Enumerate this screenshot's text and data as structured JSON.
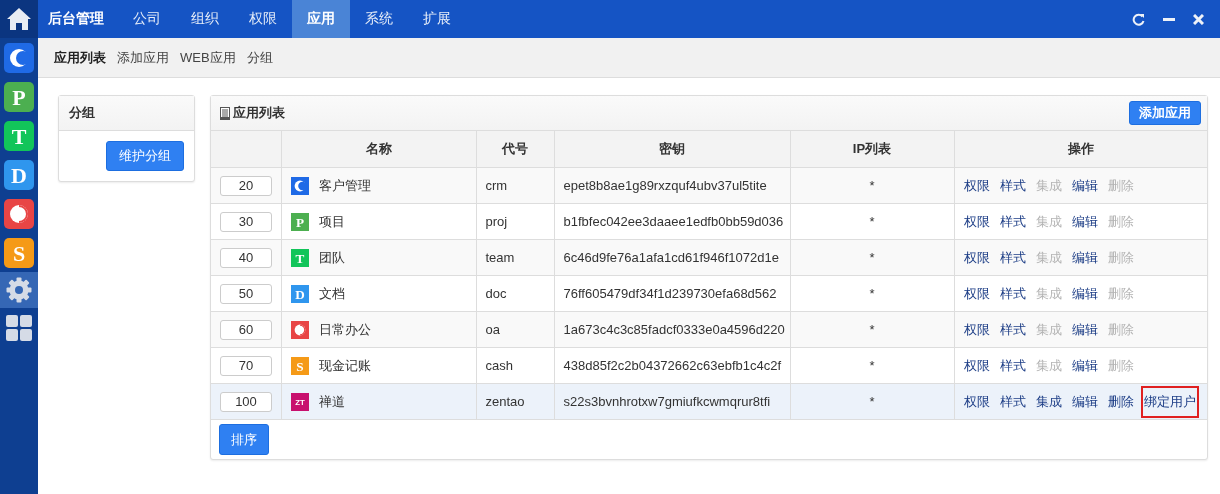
{
  "topbar": {
    "title": "后台管理",
    "tabs": [
      {
        "label": "公司",
        "selected": false
      },
      {
        "label": "组织",
        "selected": false
      },
      {
        "label": "权限",
        "selected": false
      },
      {
        "label": "应用",
        "selected": true
      },
      {
        "label": "系统",
        "selected": false
      },
      {
        "label": "扩展",
        "selected": false
      }
    ]
  },
  "sidebar": {
    "items": [
      {
        "kind": "crescent",
        "color": "#1f6ae6",
        "selected": false
      },
      {
        "kind": "letter",
        "glyph": "P",
        "color": "#4caf50",
        "selected": false
      },
      {
        "kind": "letter",
        "glyph": "T",
        "color": "#12c55a",
        "selected": false
      },
      {
        "kind": "letter",
        "glyph": "D",
        "color": "#2f96ee",
        "selected": false
      },
      {
        "kind": "half",
        "color": "#e84545",
        "selected": false
      },
      {
        "kind": "letter",
        "glyph": "S",
        "color": "#f59a17",
        "selected": false
      },
      {
        "kind": "gear",
        "selected": true
      },
      {
        "kind": "grid",
        "selected": false
      }
    ]
  },
  "subnav": [
    {
      "label": "应用列表",
      "selected": true
    },
    {
      "label": "添加应用",
      "selected": false
    },
    {
      "label": "WEB应用",
      "selected": false
    },
    {
      "label": "分组",
      "selected": false
    }
  ],
  "group_panel": {
    "title": "分组",
    "button": "维护分组"
  },
  "app_panel": {
    "title": "应用列表",
    "add_button": "添加应用",
    "columns": [
      "名称",
      "代号",
      "密钥",
      "IP列表",
      "操作"
    ],
    "rows": [
      {
        "order": "20",
        "icon": {
          "kind": "crescent",
          "color": "#1f6ae6"
        },
        "name": "客户管理",
        "code": "crm",
        "key": "epet8b8ae1g89rxzquf4ubv37ul5tite",
        "ip": "*",
        "highlighted": false,
        "actions": [
          {
            "label": "权限",
            "disabled": false,
            "outlined": false
          },
          {
            "label": "样式",
            "disabled": false,
            "outlined": false
          },
          {
            "label": "集成",
            "disabled": true,
            "outlined": false
          },
          {
            "label": "编辑",
            "disabled": false,
            "outlined": false
          },
          {
            "label": "删除",
            "disabled": true,
            "outlined": false
          }
        ]
      },
      {
        "order": "30",
        "icon": {
          "kind": "letter",
          "glyph": "P",
          "color": "#4caf50"
        },
        "name": "项目",
        "code": "proj",
        "key": "b1fbfec042ee3daaee1edfb0bb59d036",
        "ip": "*",
        "highlighted": false,
        "actions": [
          {
            "label": "权限",
            "disabled": false,
            "outlined": false
          },
          {
            "label": "样式",
            "disabled": false,
            "outlined": false
          },
          {
            "label": "集成",
            "disabled": true,
            "outlined": false
          },
          {
            "label": "编辑",
            "disabled": false,
            "outlined": false
          },
          {
            "label": "删除",
            "disabled": true,
            "outlined": false
          }
        ]
      },
      {
        "order": "40",
        "icon": {
          "kind": "letter",
          "glyph": "T",
          "color": "#12c55a"
        },
        "name": "团队",
        "code": "team",
        "key": "6c46d9fe76a1afa1cd61f946f1072d1e",
        "ip": "*",
        "highlighted": false,
        "actions": [
          {
            "label": "权限",
            "disabled": false,
            "outlined": false
          },
          {
            "label": "样式",
            "disabled": false,
            "outlined": false
          },
          {
            "label": "集成",
            "disabled": true,
            "outlined": false
          },
          {
            "label": "编辑",
            "disabled": false,
            "outlined": false
          },
          {
            "label": "删除",
            "disabled": true,
            "outlined": false
          }
        ]
      },
      {
        "order": "50",
        "icon": {
          "kind": "letter",
          "glyph": "D",
          "color": "#2f96ee"
        },
        "name": "文档",
        "code": "doc",
        "key": "76ff605479df34f1d239730efa68d562",
        "ip": "*",
        "highlighted": false,
        "actions": [
          {
            "label": "权限",
            "disabled": false,
            "outlined": false
          },
          {
            "label": "样式",
            "disabled": false,
            "outlined": false
          },
          {
            "label": "集成",
            "disabled": true,
            "outlined": false
          },
          {
            "label": "编辑",
            "disabled": false,
            "outlined": false
          },
          {
            "label": "删除",
            "disabled": true,
            "outlined": false
          }
        ]
      },
      {
        "order": "60",
        "icon": {
          "kind": "half",
          "color": "#e84545"
        },
        "name": "日常办公",
        "code": "oa",
        "key": "1a673c4c3c85fadcf0333e0a4596d220",
        "ip": "*",
        "highlighted": false,
        "actions": [
          {
            "label": "权限",
            "disabled": false,
            "outlined": false
          },
          {
            "label": "样式",
            "disabled": false,
            "outlined": false
          },
          {
            "label": "集成",
            "disabled": true,
            "outlined": false
          },
          {
            "label": "编辑",
            "disabled": false,
            "outlined": false
          },
          {
            "label": "删除",
            "disabled": true,
            "outlined": false
          }
        ]
      },
      {
        "order": "70",
        "icon": {
          "kind": "letter",
          "glyph": "S",
          "color": "#f59a17"
        },
        "name": "现金记账",
        "code": "cash",
        "key": "438d85f2c2b04372662c63ebfb1c4c2f",
        "ip": "*",
        "highlighted": false,
        "actions": [
          {
            "label": "权限",
            "disabled": false,
            "outlined": false
          },
          {
            "label": "样式",
            "disabled": false,
            "outlined": false
          },
          {
            "label": "集成",
            "disabled": true,
            "outlined": false
          },
          {
            "label": "编辑",
            "disabled": false,
            "outlined": false
          },
          {
            "label": "删除",
            "disabled": true,
            "outlined": false
          }
        ]
      },
      {
        "order": "100",
        "icon": {
          "kind": "letter",
          "glyph": "ZT",
          "color": "#c8106e"
        },
        "name": "禅道",
        "code": "zentao",
        "key": "s22s3bvnhrotxw7gmiufkcwmqrur8tfi",
        "ip": "*",
        "highlighted": true,
        "actions": [
          {
            "label": "权限",
            "disabled": false,
            "outlined": false
          },
          {
            "label": "样式",
            "disabled": false,
            "outlined": false
          },
          {
            "label": "集成",
            "disabled": false,
            "outlined": false
          },
          {
            "label": "编辑",
            "disabled": false,
            "outlined": false
          },
          {
            "label": "删除",
            "disabled": false,
            "outlined": false
          },
          {
            "label": "绑定用户",
            "disabled": false,
            "outlined": true
          }
        ]
      }
    ],
    "sort_button": "排序"
  }
}
